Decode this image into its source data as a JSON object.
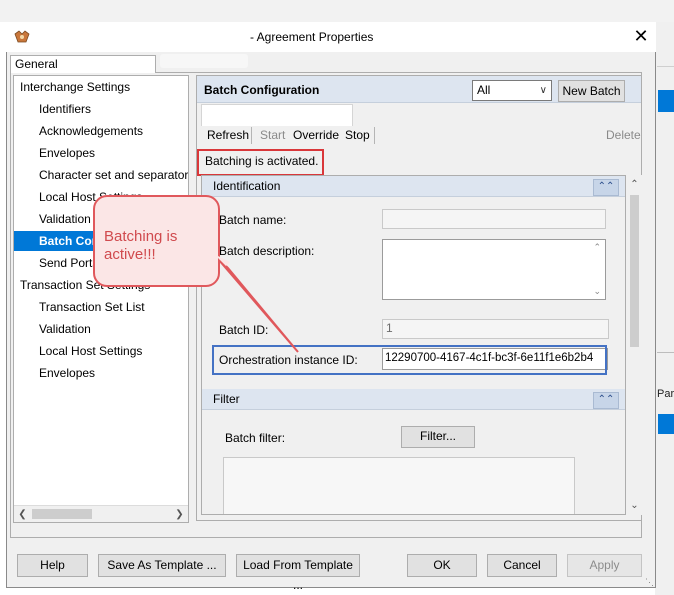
{
  "window": {
    "title": "- Agreement Properties",
    "close_label": "✕"
  },
  "tabs": {
    "general": "General"
  },
  "tree": {
    "items": [
      {
        "label": "Interchange Settings",
        "level": 0,
        "selected": false
      },
      {
        "label": "Identifiers",
        "level": 1,
        "selected": false
      },
      {
        "label": "Acknowledgements",
        "level": 1,
        "selected": false
      },
      {
        "label": "Envelopes",
        "level": 1,
        "selected": false
      },
      {
        "label": "Character set and separators",
        "level": 1,
        "selected": false
      },
      {
        "label": "Local Host Settings",
        "level": 1,
        "selected": false
      },
      {
        "label": "Validation",
        "level": 1,
        "selected": false
      },
      {
        "label": "Batch Configuration",
        "level": 1,
        "selected": true
      },
      {
        "label": "Send Ports",
        "level": 1,
        "selected": false
      },
      {
        "label": "Transaction Set Settings",
        "level": 0,
        "selected": false
      },
      {
        "label": "Transaction Set List",
        "level": 1,
        "selected": false
      },
      {
        "label": "Validation",
        "level": 1,
        "selected": false
      },
      {
        "label": "Local Host Settings",
        "level": 1,
        "selected": false
      },
      {
        "label": "Envelopes",
        "level": 1,
        "selected": false
      }
    ]
  },
  "batch": {
    "title": "Batch Configuration",
    "filter_value": "All",
    "new_batch": "New Batch",
    "toolbar": {
      "refresh": "Refresh",
      "start": "Start",
      "override": "Override",
      "stop": "Stop",
      "delete": "Delete"
    },
    "status": "Batching is activated.",
    "identification": {
      "header": "Identification",
      "batch_name_label": "Batch name:",
      "batch_description_label": "Batch description:",
      "batch_id_label": "Batch ID:",
      "batch_id_value": "1",
      "orch_label": "Orchestration instance ID:",
      "orch_value": "12290700-4167-4c1f-bc3f-6e11f1e6b2b4"
    },
    "filter": {
      "header": "Filter",
      "batch_filter_label": "Batch filter:",
      "filter_button": "Filter..."
    }
  },
  "callout": {
    "text": "Batching is active!!!"
  },
  "footer": {
    "help": "Help",
    "save_template": "Save As Template ...",
    "load_template": "Load From Template ...",
    "ok": "OK",
    "cancel": "Cancel",
    "apply": "Apply"
  },
  "background": {
    "party_fragment": "Party"
  },
  "colors": {
    "accent": "#0078d7",
    "status_highlight": "#d9373a",
    "id_highlight": "#4472c4",
    "callout_text": "#d04a4e"
  }
}
